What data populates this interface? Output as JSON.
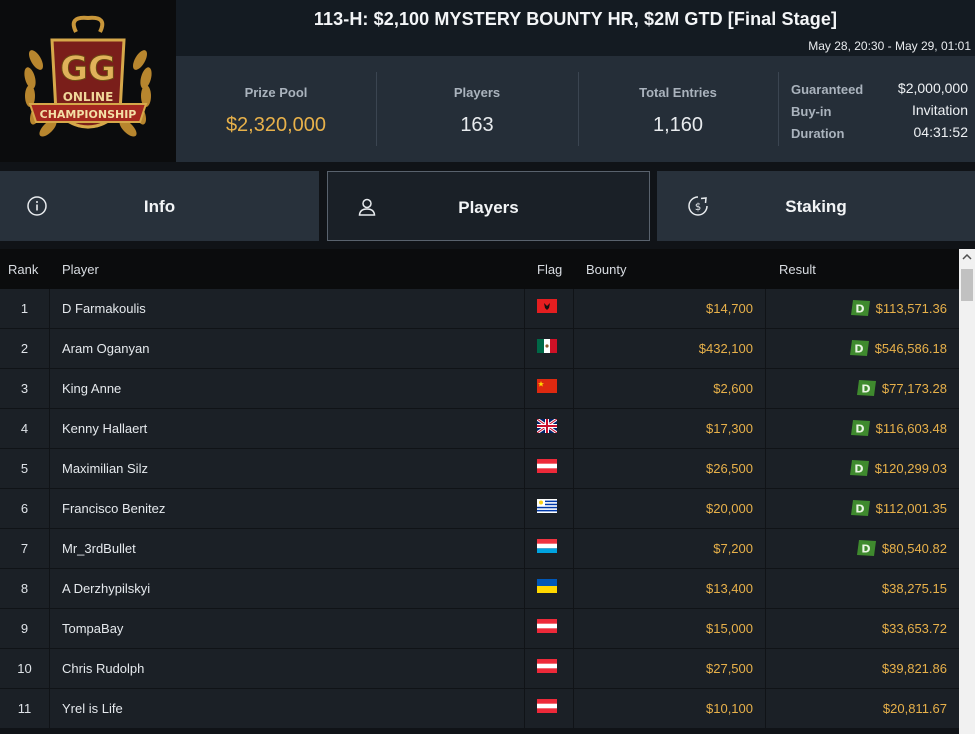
{
  "header": {
    "title": "113-H: $2,100 MYSTERY BOUNTY HR, $2M GTD [Final Stage]",
    "dates": "May 28, 20:30 - May 29, 01:01",
    "logo_text_top": "ONLINE",
    "logo_text_bottom": "CHAMPIONSHIP",
    "stats": [
      {
        "label": "Prize Pool",
        "value": "$2,320,000"
      },
      {
        "label": "Players",
        "value": "163"
      },
      {
        "label": "Total Entries",
        "value": "1,160"
      }
    ],
    "meta": [
      {
        "key": "Guaranteed",
        "value": "$2,000,000"
      },
      {
        "key": "Buy-in",
        "value": "Invitation"
      },
      {
        "key": "Duration",
        "value": "04:31:52"
      }
    ]
  },
  "tabs": [
    {
      "label": "Info",
      "icon": "info-icon"
    },
    {
      "label": "Players",
      "icon": "user-icon"
    },
    {
      "label": "Staking",
      "icon": "coin-dollar-icon"
    }
  ],
  "table": {
    "headers": [
      "Rank",
      "Player",
      "Flag",
      "Bounty",
      "Result"
    ],
    "rows": [
      {
        "rank": "1",
        "player": "D Farmakoulis",
        "flag": "albania",
        "bounty": "$14,700",
        "result": "$113,571.36",
        "badge": true
      },
      {
        "rank": "2",
        "player": "Aram Oganyan",
        "flag": "mexico",
        "bounty": "$432,100",
        "result": "$546,586.18",
        "badge": true
      },
      {
        "rank": "3",
        "player": "King Anne",
        "flag": "china",
        "bounty": "$2,600",
        "result": "$77,173.28",
        "badge": true
      },
      {
        "rank": "4",
        "player": "Kenny Hallaert",
        "flag": "uk",
        "bounty": "$17,300",
        "result": "$116,603.48",
        "badge": true
      },
      {
        "rank": "5",
        "player": "Maximilian Silz",
        "flag": "austria",
        "bounty": "$26,500",
        "result": "$120,299.03",
        "badge": true
      },
      {
        "rank": "6",
        "player": "Francisco Benitez",
        "flag": "uruguay",
        "bounty": "$20,000",
        "result": "$112,001.35",
        "badge": true
      },
      {
        "rank": "7",
        "player": "Mr_3rdBullet",
        "flag": "luxembourg",
        "bounty": "$7,200",
        "result": "$80,540.82",
        "badge": true
      },
      {
        "rank": "8",
        "player": "A Derzhypilskyi",
        "flag": "ukraine",
        "bounty": "$13,400",
        "result": "$38,275.15",
        "badge": false
      },
      {
        "rank": "9",
        "player": "TompaBay",
        "flag": "austria",
        "bounty": "$15,000",
        "result": "$33,653.72",
        "badge": false
      },
      {
        "rank": "10",
        "player": "Chris Rudolph",
        "flag": "austria",
        "bounty": "$27,500",
        "result": "$39,821.86",
        "badge": false
      },
      {
        "rank": "11",
        "player": "Yrel is Life",
        "flag": "austria",
        "bounty": "$10,100",
        "result": "$20,811.67",
        "badge": false
      }
    ]
  },
  "colors": {
    "gold": "#e8b14a",
    "badge_green": "#3f8a2e",
    "panel": "#252e38"
  }
}
